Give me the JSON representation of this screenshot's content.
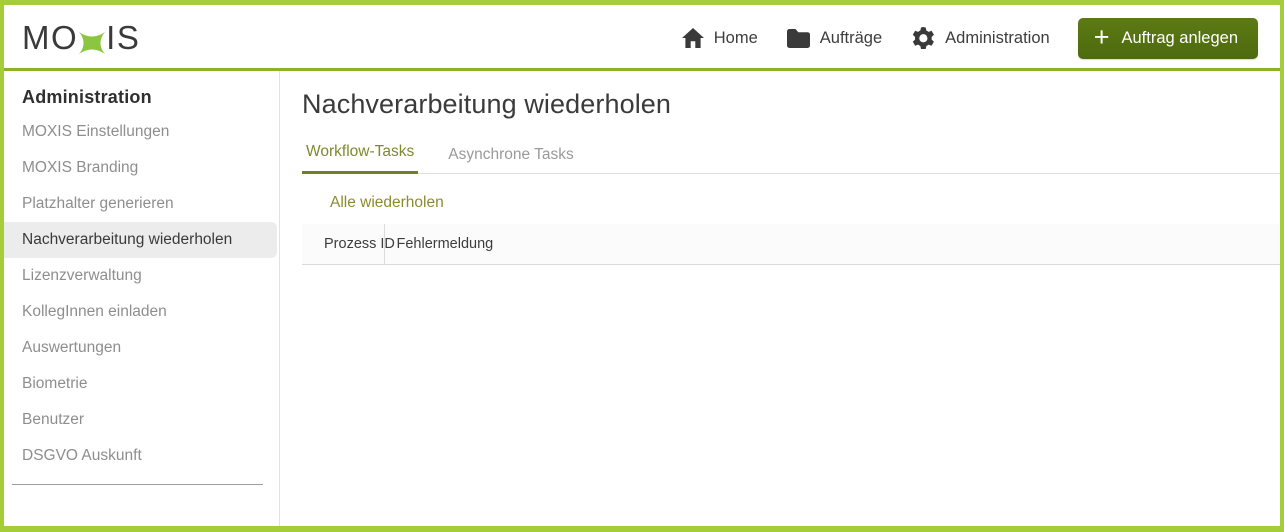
{
  "brand": {
    "logo_text_left": "MO",
    "logo_text_right": "IS",
    "logo_x_icon": "moxis-x-icon",
    "accent_green": "#a5cd39",
    "olive_green": "#8a8c2e",
    "button_green": "#5c7a14",
    "header_rule_dark": "#2e5a4d"
  },
  "header": {
    "nav": [
      {
        "label": "Home",
        "icon": "home-icon"
      },
      {
        "label": "Aufträge",
        "icon": "folder-icon"
      },
      {
        "label": "Administration",
        "icon": "gear-icon"
      }
    ],
    "cta": {
      "label": "Auftrag anlegen",
      "icon": "plus-icon"
    }
  },
  "sidebar": {
    "title": "Administration",
    "items": [
      {
        "label": "MOXIS Einstellungen",
        "active": false
      },
      {
        "label": "MOXIS Branding",
        "active": false
      },
      {
        "label": "Platzhalter generieren",
        "active": false
      },
      {
        "label": "Nachverarbeitung wiederholen",
        "active": true
      },
      {
        "label": "Lizenzverwaltung",
        "active": false
      },
      {
        "label": "KollegInnen einladen",
        "active": false
      },
      {
        "label": "Auswertungen",
        "active": false
      },
      {
        "label": "Biometrie",
        "active": false
      },
      {
        "label": "Benutzer",
        "active": false
      },
      {
        "label": "DSGVO Auskunft",
        "active": false
      }
    ]
  },
  "main": {
    "page_title": "Nachverarbeitung wiederholen",
    "tabs": [
      {
        "label": "Workflow-Tasks",
        "active": true
      },
      {
        "label": "Asynchrone Tasks",
        "active": false
      }
    ],
    "retry_all_label": "Alle wiederholen",
    "table": {
      "columns": [
        "Prozess ID",
        "Fehlermeldung"
      ],
      "rows": []
    }
  }
}
